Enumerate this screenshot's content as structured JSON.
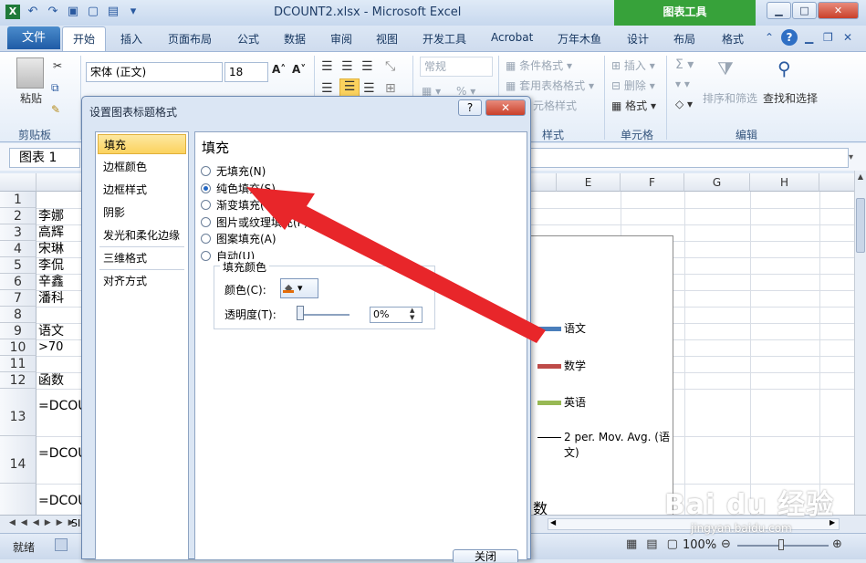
{
  "window": {
    "title": "DCOUNT2.xlsx - Microsoft Excel",
    "chart_tools": "图表工具",
    "min": "▁",
    "max": "□",
    "close": "✕"
  },
  "tabs": {
    "file": "文件",
    "items": [
      "开始",
      "插入",
      "页面布局",
      "公式",
      "数据",
      "审阅",
      "视图",
      "开发工具",
      "Acrobat",
      "万年木鱼"
    ],
    "chart_tabs": [
      "设计",
      "布局",
      "格式"
    ]
  },
  "ribbon": {
    "paste": "粘贴",
    "clipboard": "剪贴板",
    "font_name": "宋体 (正文)",
    "font_size": "18",
    "number_format": "常规",
    "cond_format": "条件格式",
    "table_format": "套用表格格式",
    "cell_style": "元格样式",
    "style_group": "样式",
    "insert": "插入",
    "delete": "删除",
    "format": "格式",
    "cells_group": "单元格",
    "sort_filter": "排序和筛选",
    "find_select": "查找和选择",
    "edit_group": "编辑"
  },
  "formula_bar": {
    "name_box": "图表 1"
  },
  "grid": {
    "columns": [
      "E",
      "F",
      "G",
      "H"
    ],
    "rows": [
      {
        "num": "1",
        "text": ""
      },
      {
        "num": "2",
        "text": "李娜"
      },
      {
        "num": "3",
        "text": "高辉"
      },
      {
        "num": "4",
        "text": "宋琳"
      },
      {
        "num": "5",
        "text": "李侃"
      },
      {
        "num": "6",
        "text": "辛鑫"
      },
      {
        "num": "7",
        "text": "潘科"
      },
      {
        "num": "8",
        "text": ""
      },
      {
        "num": "9",
        "text": "语文"
      },
      {
        "num": "10",
        "text": ">70"
      },
      {
        "num": "11",
        "text": ""
      },
      {
        "num": "12",
        "text": "函数"
      },
      {
        "num": "13",
        "text": "=DCOUN"
      },
      {
        "num": "14",
        "text": "=DCOUN"
      },
      {
        "num": "",
        "text": "=DCOUN"
      }
    ],
    "partial_cell": "数",
    "legend": [
      {
        "label": "语文",
        "color": "#4a7ebb"
      },
      {
        "label": "数学",
        "color": "#be4b48"
      },
      {
        "label": "英语",
        "color": "#98b954"
      },
      {
        "label": "2 per. Mov. Avg. (语",
        "label2": "文)",
        "color": "#000000"
      }
    ]
  },
  "sheet_tab": "SI",
  "status": {
    "ready": "就绪",
    "zoom": "100%"
  },
  "dialog": {
    "title": "设置图表标题格式",
    "help": "?",
    "close": "✕",
    "categories": [
      "填充",
      "边框颜色",
      "边框样式",
      "阴影",
      "发光和柔化边缘",
      "三维格式",
      "对齐方式"
    ],
    "panel_title": "填充",
    "options": [
      "无填充(N)",
      "纯色填充(S)",
      "渐变填充(G)",
      "图片或纹理填充(P)",
      "图案填充(A)",
      "自动(U)"
    ],
    "selected_option": 1,
    "fill_color_group": "填充颜色",
    "color_label": "颜色(C):",
    "transparency_label": "透明度(T):",
    "transparency_value": "0%",
    "close_button": "关闭"
  },
  "watermark": {
    "brand": "Bai du 经验",
    "url": "jingyan.baidu.com"
  }
}
